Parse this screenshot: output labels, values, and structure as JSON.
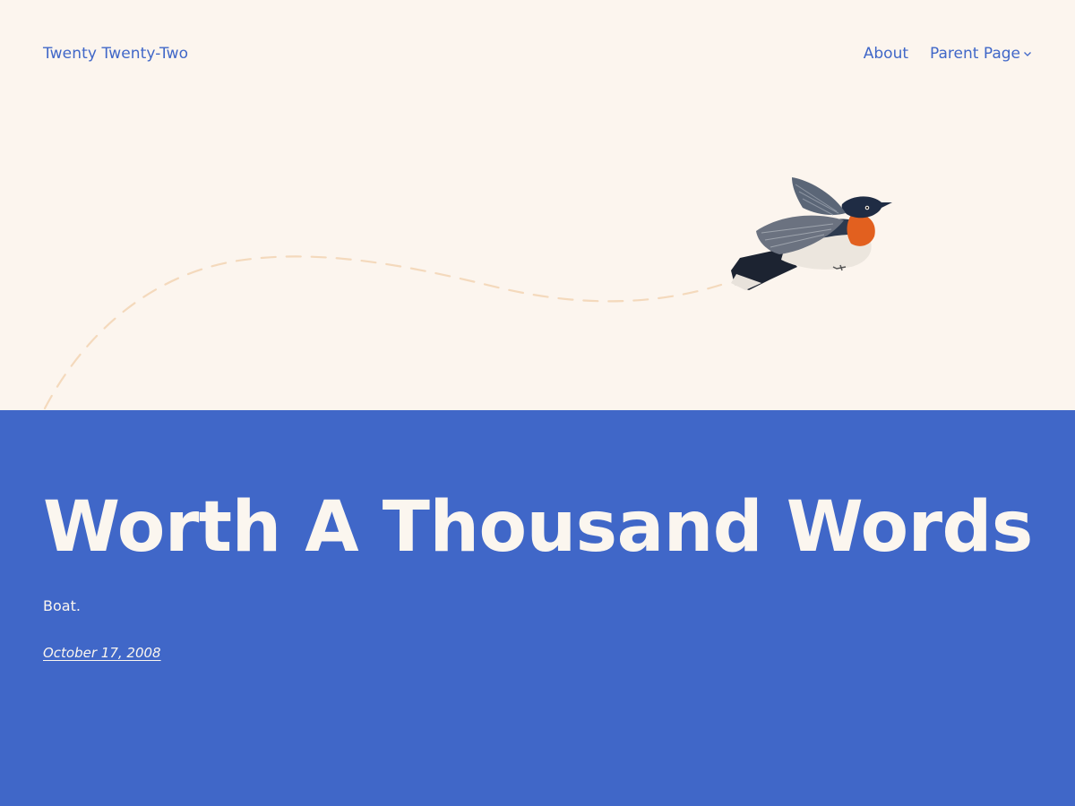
{
  "header": {
    "site_title": "Twenty Twenty-Two",
    "nav": {
      "about": "About",
      "parent_page": "Parent Page"
    }
  },
  "post": {
    "title": "Worth A Thousand Words",
    "excerpt": "Boat.",
    "date": "October 17, 2008"
  },
  "colors": {
    "hero_background": "#fcf5ee",
    "content_background": "#4067c8",
    "accent_text": "#4067c8",
    "light_text": "#fbf6ef",
    "dashed_path": "#f4d9bc"
  },
  "icons": {
    "dropdown": "chevron-down-icon",
    "illustration": "bird-flight-illustration"
  }
}
